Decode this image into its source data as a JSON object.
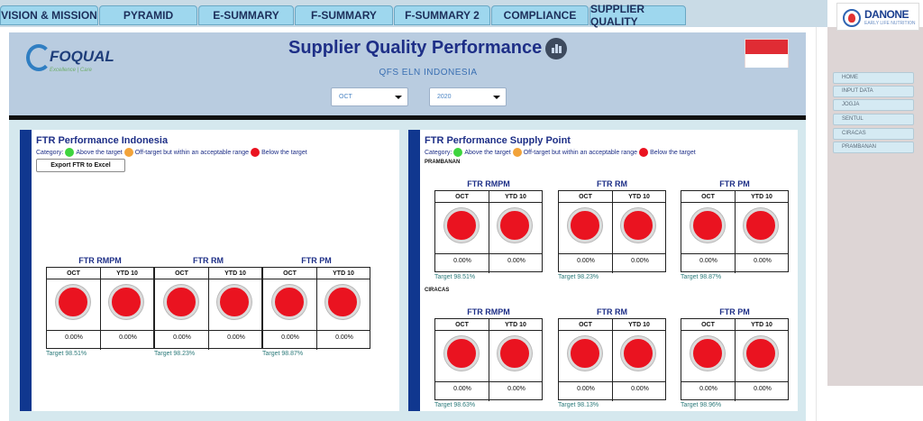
{
  "tabs": [
    "VISION & MISSION",
    "PYRAMID",
    "E-SUMMARY",
    "F-SUMMARY",
    "F-SUMMARY 2",
    "COMPLIANCE",
    "SUPPLIER QUALITY"
  ],
  "brand": {
    "name": "DANONE",
    "sub": "EARLY LIFE NUTRITION"
  },
  "sidenav": [
    "HOME",
    "INPUT DATA",
    "JOGJA",
    "SENTUL",
    "CIRACAS",
    "PRAMBANAN"
  ],
  "header": {
    "logo": "FOQUAL",
    "logo_sub": "Excellence | Care",
    "title": "Supplier Quality Performance",
    "subtitle": "QFS ELN INDONESIA",
    "month": "OCT",
    "year": "2020"
  },
  "legend": {
    "label": "Category:",
    "above": "Above the target",
    "off": "Off-target but within an acceptable range",
    "below": "Below the target",
    "colors": {
      "above": "#3ed43e",
      "off": "#f2a33a",
      "below": "#ea1320"
    }
  },
  "indonesia": {
    "title": "FTR Performance Indonesia",
    "export_label": "Export FTR to Excel",
    "gauges": [
      {
        "title": "FTR RMPM",
        "h1": "OCT",
        "h2": "YTD 10",
        "v1": "0.00%",
        "v2": "0.00%",
        "target": "Target 98.51%"
      },
      {
        "title": "FTR RM",
        "h1": "OCT",
        "h2": "YTD 10",
        "v1": "0.00%",
        "v2": "0.00%",
        "target": "Target 98.23%"
      },
      {
        "title": "FTR PM",
        "h1": "OCT",
        "h2": "YTD 10",
        "v1": "0.00%",
        "v2": "0.00%",
        "target": "Target 98.87%"
      }
    ]
  },
  "supply": {
    "title": "FTR Performance Supply Point",
    "groups": [
      {
        "name": "PRAMBANAN",
        "gauges": [
          {
            "title": "FTR RMPM",
            "h1": "OCT",
            "h2": "YTD 10",
            "v1": "0.00%",
            "v2": "0.00%",
            "target": "Target 98.51%"
          },
          {
            "title": "FTR RM",
            "h1": "OCT",
            "h2": "YTD 10",
            "v1": "0.00%",
            "v2": "0.00%",
            "target": "Target 98.23%"
          },
          {
            "title": "FTR PM",
            "h1": "OCT",
            "h2": "YTD 10",
            "v1": "0.00%",
            "v2": "0.00%",
            "target": "Target 98.87%"
          }
        ]
      },
      {
        "name": "CIRACAS",
        "gauges": [
          {
            "title": "FTR RMPM",
            "h1": "OCT",
            "h2": "YTD 10",
            "v1": "0.00%",
            "v2": "0.00%",
            "target": "Target 98.63%"
          },
          {
            "title": "FTR RM",
            "h1": "OCT",
            "h2": "YTD 10",
            "v1": "0.00%",
            "v2": "0.00%",
            "target": "Target 98.13%"
          },
          {
            "title": "FTR PM",
            "h1": "OCT",
            "h2": "YTD 10",
            "v1": "0.00%",
            "v2": "0.00%",
            "target": "Target 98.96%"
          }
        ]
      }
    ]
  }
}
